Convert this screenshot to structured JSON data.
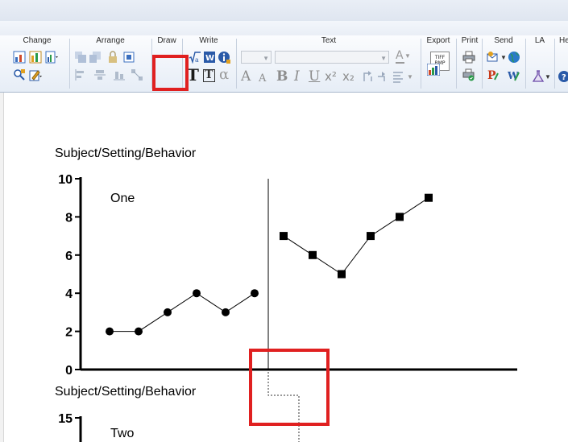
{
  "ribbon": {
    "groups": [
      {
        "id": "change",
        "label": "Change"
      },
      {
        "id": "arrange",
        "label": "Arrange"
      },
      {
        "id": "draw",
        "label": "Draw"
      },
      {
        "id": "write",
        "label": "Write"
      },
      {
        "id": "text",
        "label": "Text"
      },
      {
        "id": "export",
        "label": "Export"
      },
      {
        "id": "print",
        "label": "Print"
      },
      {
        "id": "send",
        "label": "Send"
      },
      {
        "id": "la",
        "label": "LA"
      },
      {
        "id": "help",
        "label": "He"
      }
    ],
    "export_icon_text": [
      "TIFF",
      "BMP"
    ],
    "text_glyphs": {
      "grow": "A",
      "shrink": "A",
      "bold": "B",
      "italic": "I",
      "underline": "U",
      "superscript": "x²",
      "subscript": "x₂",
      "alpha": "α",
      "big_t": "T",
      "box_t": "T"
    },
    "colors": {
      "highlight": "#e02020",
      "accent": "#2a5aa8"
    }
  },
  "chart_data": [
    {
      "type": "line",
      "title": "Subject/Setting/Behavior",
      "panel_label": "One",
      "ylim": [
        0,
        10
      ],
      "yticks": [
        "10",
        "8",
        "6",
        "4",
        "2",
        "0"
      ],
      "phase_change_after": 6,
      "series": [
        {
          "phase": "A",
          "marker": "circle",
          "x": [
            1,
            2,
            3,
            4,
            5,
            6
          ],
          "values": [
            2,
            2,
            3,
            4,
            3,
            4
          ]
        },
        {
          "phase": "B",
          "marker": "square",
          "x": [
            7,
            8,
            9,
            10,
            11,
            12
          ],
          "values": [
            7,
            6,
            5,
            7,
            8,
            9
          ]
        }
      ]
    },
    {
      "type": "line",
      "title": "Subject/Setting/Behavior",
      "panel_label": "Two",
      "yticks": [
        "15"
      ]
    }
  ]
}
